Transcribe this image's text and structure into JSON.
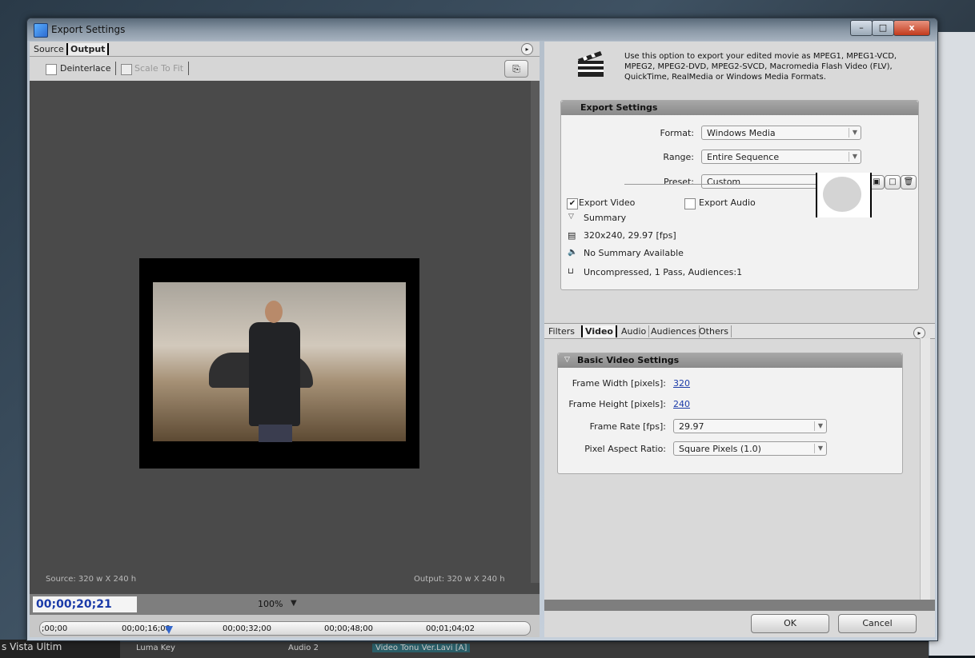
{
  "window": {
    "title": "Export Settings",
    "min": "–",
    "max": "□",
    "close": "x"
  },
  "left": {
    "tabs": [
      "Source",
      "Output"
    ],
    "toolbar": {
      "deinterlace": "Deinterlace",
      "scale_to_fit": "Scale To Fit"
    },
    "source_info": "Source: 320 w X 240 h",
    "output_info": "Output: 320 w X 240 h",
    "timecode": "00;00;20;21",
    "zoom": "100%",
    "ruler_ticks": [
      ";00;00",
      "00;00;16;00",
      "00;00;32;00",
      "00;00;48;00",
      "00;01;04;02"
    ]
  },
  "right": {
    "description": "Use this option to export your edited movie as MPEG1, MPEG1-VCD, MPEG2, MPEG2-DVD, MPEG2-SVCD, Macromedia Flash Video (FLV), QuickTime, RealMedia or Windows Media Formats.",
    "export_settings": {
      "heading": "Export Settings",
      "format_label": "Format:",
      "format_value": "Windows Media",
      "range_label": "Range:",
      "range_value": "Entire Sequence",
      "preset_label": "Preset:",
      "preset_value": "Custom",
      "export_video": "Export Video",
      "export_audio": "Export Audio",
      "export_video_checked": true,
      "export_audio_checked": false,
      "summary_label": "Summary",
      "summary_video": "320x240, 29.97 [fps]",
      "summary_audio": "No Summary Available",
      "summary_other": "Uncompressed, 1 Pass, Audiences:1"
    },
    "tabs": [
      "Filters",
      "Video",
      "Audio",
      "Audiences",
      "Others"
    ],
    "basic_video": {
      "heading": "Basic Video Settings",
      "width_label": "Frame Width [pixels]:",
      "width_value": "320",
      "height_label": "Frame Height [pixels]:",
      "height_value": "240",
      "rate_label": "Frame Rate [fps]:",
      "rate_value": "29.97",
      "par_label": "Pixel Aspect Ratio:",
      "par_value": "Square Pixels (1.0)"
    },
    "ok": "OK",
    "cancel": "Cancel"
  },
  "background": {
    "taskbar_left": "s Vista  Ultim",
    "taskbar_items": [
      "Luma Key",
      "Audio 2",
      "Video Tonu Ver.Lavi [A]"
    ]
  }
}
